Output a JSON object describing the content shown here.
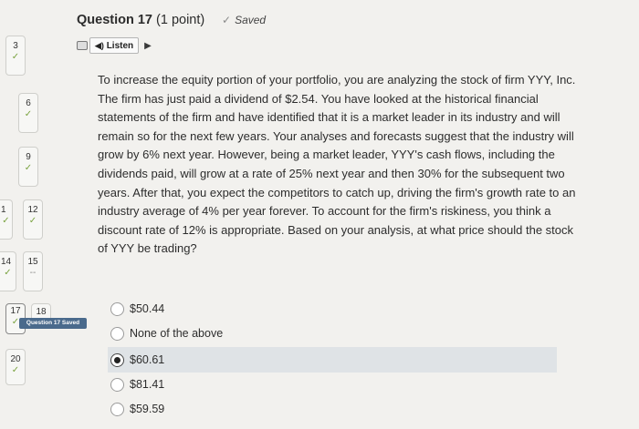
{
  "header": {
    "title_strong": "Question 17",
    "title_points": "(1 point)",
    "saved_check": "✓",
    "saved_label": "Saved",
    "listen_label": "Listen",
    "play_icon": "play-icon"
  },
  "nav": {
    "tiles": [
      {
        "num": "3",
        "mark": "✓"
      },
      {
        "num": "6",
        "mark": "✓"
      },
      {
        "num": "9",
        "mark": "✓"
      },
      {
        "num": "1",
        "mark": "✓"
      },
      {
        "num": "12",
        "mark": "✓"
      },
      {
        "num": "14",
        "mark": "✓"
      },
      {
        "num": "15",
        "mark": "--"
      },
      {
        "num": "17",
        "mark": "✓"
      },
      {
        "num": "18",
        "mark": ""
      },
      {
        "num": "20",
        "mark": "✓"
      }
    ],
    "tooltip": "Question 17 Saved"
  },
  "question": {
    "text": "To increase the equity portion of your portfolio, you are analyzing the stock of firm YYY, Inc. The firm has just paid a dividend of $2.54. You have looked at the historical financial statements of the firm and have identified that it is a market leader in its industry and will remain so for the next few years. Your analyses and forecasts suggest that the industry will grow by 6% next year. However, being a market leader, YYY's cash flows, including the dividends paid, will grow at a rate of 25% next year and then 30% for the subsequent two years. After that, you expect the competitors to catch up, driving the firm's growth rate to an industry average of 4% per year forever. To account for the firm's riskiness, you think a discount rate of 12% is appropriate. Based on your analysis, at what price should the stock of YYY be trading?"
  },
  "options": [
    {
      "label": "$50.44",
      "selected": false
    },
    {
      "label": "None of the above",
      "selected": false
    },
    {
      "label": "$60.61",
      "selected": true
    },
    {
      "label": "$81.41",
      "selected": false
    },
    {
      "label": "$59.59",
      "selected": false
    }
  ]
}
